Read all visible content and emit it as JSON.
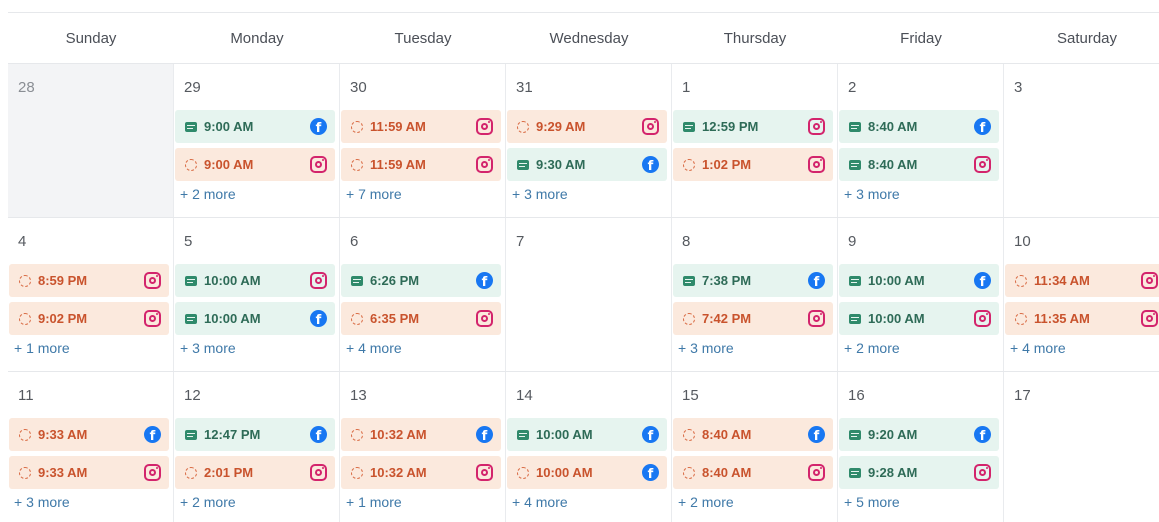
{
  "colors": {
    "published_bg": "#e6f4ef",
    "published_text": "#2e6b57",
    "scheduled_bg": "#fbe9dd",
    "scheduled_text": "#c9532d",
    "facebook": "#1877f2",
    "instagram": "#d3246c",
    "more_link": "#3f79a8"
  },
  "days_of_week": [
    "Sunday",
    "Monday",
    "Tuesday",
    "Wednesday",
    "Thursday",
    "Friday",
    "Saturday"
  ],
  "weeks": [
    [
      {
        "date": "28",
        "muted": true,
        "posts": [],
        "more": ""
      },
      {
        "date": "29",
        "posts": [
          {
            "time": "9:00 AM",
            "status": "published",
            "network": "facebook"
          },
          {
            "time": "9:00 AM",
            "status": "scheduled",
            "network": "instagram"
          }
        ],
        "more": "+ 2 more"
      },
      {
        "date": "30",
        "posts": [
          {
            "time": "11:59 AM",
            "status": "scheduled",
            "network": "instagram"
          },
          {
            "time": "11:59 AM",
            "status": "scheduled",
            "network": "instagram"
          }
        ],
        "more": "+ 7 more"
      },
      {
        "date": "31",
        "posts": [
          {
            "time": "9:29 AM",
            "status": "scheduled",
            "network": "instagram"
          },
          {
            "time": "9:30 AM",
            "status": "published",
            "network": "facebook"
          }
        ],
        "more": "+ 3 more"
      },
      {
        "date": "1",
        "posts": [
          {
            "time": "12:59 PM",
            "status": "published",
            "network": "instagram"
          },
          {
            "time": "1:02 PM",
            "status": "scheduled",
            "network": "instagram"
          }
        ],
        "more": ""
      },
      {
        "date": "2",
        "posts": [
          {
            "time": "8:40 AM",
            "status": "published",
            "network": "facebook"
          },
          {
            "time": "8:40 AM",
            "status": "published",
            "network": "instagram"
          }
        ],
        "more": "+ 3 more"
      },
      {
        "date": "3",
        "posts": [],
        "more": ""
      }
    ],
    [
      {
        "date": "4",
        "posts": [
          {
            "time": "8:59 PM",
            "status": "scheduled",
            "network": "instagram"
          },
          {
            "time": "9:02 PM",
            "status": "scheduled",
            "network": "instagram"
          }
        ],
        "more": "+ 1 more"
      },
      {
        "date": "5",
        "posts": [
          {
            "time": "10:00 AM",
            "status": "published",
            "network": "instagram"
          },
          {
            "time": "10:00 AM",
            "status": "published",
            "network": "facebook"
          }
        ],
        "more": "+ 3 more"
      },
      {
        "date": "6",
        "posts": [
          {
            "time": "6:26 PM",
            "status": "published",
            "network": "facebook"
          },
          {
            "time": "6:35 PM",
            "status": "scheduled",
            "network": "instagram"
          }
        ],
        "more": "+ 4 more"
      },
      {
        "date": "7",
        "posts": [],
        "more": ""
      },
      {
        "date": "8",
        "posts": [
          {
            "time": "7:38 PM",
            "status": "published",
            "network": "facebook"
          },
          {
            "time": "7:42 PM",
            "status": "scheduled",
            "network": "instagram"
          }
        ],
        "more": "+ 3 more"
      },
      {
        "date": "9",
        "posts": [
          {
            "time": "10:00 AM",
            "status": "published",
            "network": "facebook"
          },
          {
            "time": "10:00 AM",
            "status": "published",
            "network": "instagram"
          }
        ],
        "more": "+ 2 more"
      },
      {
        "date": "10",
        "posts": [
          {
            "time": "11:34 AM",
            "status": "scheduled",
            "network": "instagram"
          },
          {
            "time": "11:35 AM",
            "status": "scheduled",
            "network": "instagram"
          }
        ],
        "more": "+ 4 more"
      }
    ],
    [
      {
        "date": "11",
        "posts": [
          {
            "time": "9:33 AM",
            "status": "scheduled",
            "network": "facebook"
          },
          {
            "time": "9:33 AM",
            "status": "scheduled",
            "network": "instagram"
          }
        ],
        "more": "+ 3 more"
      },
      {
        "date": "12",
        "posts": [
          {
            "time": "12:47 PM",
            "status": "published",
            "network": "facebook"
          },
          {
            "time": "2:01 PM",
            "status": "scheduled",
            "network": "instagram"
          }
        ],
        "more": "+ 2 more"
      },
      {
        "date": "13",
        "posts": [
          {
            "time": "10:32 AM",
            "status": "scheduled",
            "network": "facebook"
          },
          {
            "time": "10:32 AM",
            "status": "scheduled",
            "network": "instagram"
          }
        ],
        "more": "+ 1 more"
      },
      {
        "date": "14",
        "posts": [
          {
            "time": "10:00 AM",
            "status": "published",
            "network": "facebook"
          },
          {
            "time": "10:00 AM",
            "status": "scheduled",
            "network": "facebook"
          }
        ],
        "more": "+ 4 more"
      },
      {
        "date": "15",
        "posts": [
          {
            "time": "8:40 AM",
            "status": "scheduled",
            "network": "facebook"
          },
          {
            "time": "8:40 AM",
            "status": "scheduled",
            "network": "instagram"
          }
        ],
        "more": "+ 2 more"
      },
      {
        "date": "16",
        "posts": [
          {
            "time": "9:20 AM",
            "status": "published",
            "network": "facebook"
          },
          {
            "time": "9:28 AM",
            "status": "published",
            "network": "instagram"
          }
        ],
        "more": "+ 5 more"
      },
      {
        "date": "17",
        "posts": [],
        "more": ""
      }
    ]
  ]
}
